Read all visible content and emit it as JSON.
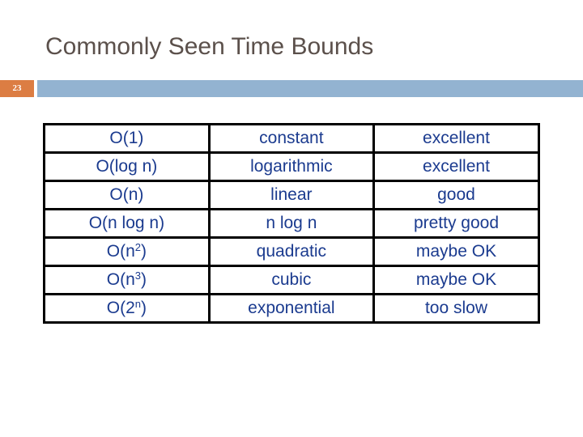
{
  "slide": {
    "title": "Commonly Seen Time Bounds",
    "slide_number": "23",
    "colors": {
      "title_text": "#5b504b",
      "slide_number_box": "#dc7d43",
      "header_bar": "#93b3d1",
      "table_text": "#1b3b8f",
      "table_border": "#000000"
    }
  },
  "table": {
    "rows": [
      {
        "bound": {
          "base": "O(1)",
          "sup": "",
          "tail": ""
        },
        "name": "constant",
        "rating": "excellent"
      },
      {
        "bound": {
          "base": "O(log n)",
          "sup": "",
          "tail": ""
        },
        "name": "logarithmic",
        "rating": "excellent"
      },
      {
        "bound": {
          "base": "O(n)",
          "sup": "",
          "tail": ""
        },
        "name": "linear",
        "rating": "good"
      },
      {
        "bound": {
          "base": "O(n log n)",
          "sup": "",
          "tail": ""
        },
        "name": "n log n",
        "rating": "pretty good"
      },
      {
        "bound": {
          "base": "O(n",
          "sup": "2",
          "tail": ")"
        },
        "name": "quadratic",
        "rating": "maybe OK"
      },
      {
        "bound": {
          "base": "O(n",
          "sup": "3",
          "tail": ")"
        },
        "name": "cubic",
        "rating": "maybe OK"
      },
      {
        "bound": {
          "base": "O(2",
          "sup": "n",
          "tail": ")"
        },
        "name": "exponential",
        "rating": "too slow"
      }
    ]
  }
}
